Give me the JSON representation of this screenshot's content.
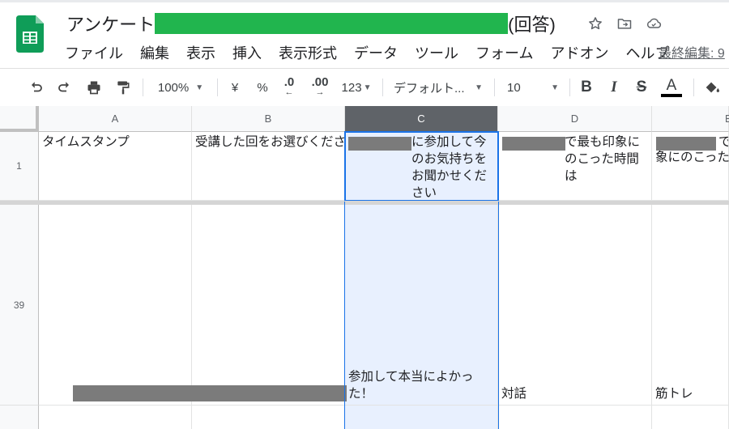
{
  "document": {
    "title_prefix": "アンケート",
    "title_suffix": "(回答)",
    "last_edit": "最終編集: 9"
  },
  "menu": [
    "ファイル",
    "編集",
    "表示",
    "挿入",
    "表示形式",
    "データ",
    "ツール",
    "フォーム",
    "アドオン",
    "ヘルプ"
  ],
  "toolbar": {
    "zoom": "100%",
    "currency": "¥",
    "percent": "%",
    "decrease_decimal": ".0",
    "increase_decimal": ".00",
    "more_formats": "123",
    "font": "デフォルト...",
    "font_size": "10",
    "bold": "B",
    "italic": "I",
    "strike": "S",
    "text_color": "A"
  },
  "columns": [
    "A",
    "B",
    "C",
    "D",
    "E"
  ],
  "rows": {
    "r1": {
      "number": "1",
      "a": "タイムスタンプ",
      "b": "受講した回をお選びくださ",
      "c": "に参加して今のお気持ちをお聞かせください",
      "d": "で最も印象にのこった時間は",
      "e_line1": "で",
      "e_line2": "象にのこった"
    },
    "r39": {
      "number": "39",
      "c": "参加して本当によかった！",
      "d": "対話",
      "e": "筋トレ"
    }
  },
  "colors": {
    "redaction_green": "#21b54e",
    "redaction_grey": "#7b7b7b",
    "selection_blue": "#1a73e8",
    "selection_fill": "#e8f0fe",
    "sheets_green": "#0f9d58"
  }
}
